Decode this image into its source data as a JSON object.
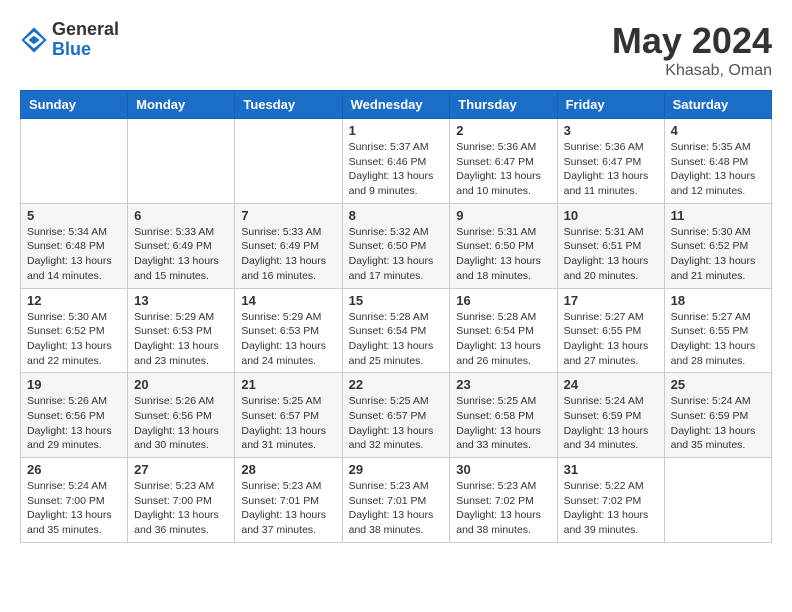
{
  "logo": {
    "general": "General",
    "blue": "Blue"
  },
  "title": {
    "month_year": "May 2024",
    "location": "Khasab, Oman"
  },
  "days_of_week": [
    "Sunday",
    "Monday",
    "Tuesday",
    "Wednesday",
    "Thursday",
    "Friday",
    "Saturday"
  ],
  "weeks": [
    [
      {
        "num": "",
        "detail": ""
      },
      {
        "num": "",
        "detail": ""
      },
      {
        "num": "",
        "detail": ""
      },
      {
        "num": "1",
        "detail": "Sunrise: 5:37 AM\nSunset: 6:46 PM\nDaylight: 13 hours\nand 9 minutes."
      },
      {
        "num": "2",
        "detail": "Sunrise: 5:36 AM\nSunset: 6:47 PM\nDaylight: 13 hours\nand 10 minutes."
      },
      {
        "num": "3",
        "detail": "Sunrise: 5:36 AM\nSunset: 6:47 PM\nDaylight: 13 hours\nand 11 minutes."
      },
      {
        "num": "4",
        "detail": "Sunrise: 5:35 AM\nSunset: 6:48 PM\nDaylight: 13 hours\nand 12 minutes."
      }
    ],
    [
      {
        "num": "5",
        "detail": "Sunrise: 5:34 AM\nSunset: 6:48 PM\nDaylight: 13 hours\nand 14 minutes."
      },
      {
        "num": "6",
        "detail": "Sunrise: 5:33 AM\nSunset: 6:49 PM\nDaylight: 13 hours\nand 15 minutes."
      },
      {
        "num": "7",
        "detail": "Sunrise: 5:33 AM\nSunset: 6:49 PM\nDaylight: 13 hours\nand 16 minutes."
      },
      {
        "num": "8",
        "detail": "Sunrise: 5:32 AM\nSunset: 6:50 PM\nDaylight: 13 hours\nand 17 minutes."
      },
      {
        "num": "9",
        "detail": "Sunrise: 5:31 AM\nSunset: 6:50 PM\nDaylight: 13 hours\nand 18 minutes."
      },
      {
        "num": "10",
        "detail": "Sunrise: 5:31 AM\nSunset: 6:51 PM\nDaylight: 13 hours\nand 20 minutes."
      },
      {
        "num": "11",
        "detail": "Sunrise: 5:30 AM\nSunset: 6:52 PM\nDaylight: 13 hours\nand 21 minutes."
      }
    ],
    [
      {
        "num": "12",
        "detail": "Sunrise: 5:30 AM\nSunset: 6:52 PM\nDaylight: 13 hours\nand 22 minutes."
      },
      {
        "num": "13",
        "detail": "Sunrise: 5:29 AM\nSunset: 6:53 PM\nDaylight: 13 hours\nand 23 minutes."
      },
      {
        "num": "14",
        "detail": "Sunrise: 5:29 AM\nSunset: 6:53 PM\nDaylight: 13 hours\nand 24 minutes."
      },
      {
        "num": "15",
        "detail": "Sunrise: 5:28 AM\nSunset: 6:54 PM\nDaylight: 13 hours\nand 25 minutes."
      },
      {
        "num": "16",
        "detail": "Sunrise: 5:28 AM\nSunset: 6:54 PM\nDaylight: 13 hours\nand 26 minutes."
      },
      {
        "num": "17",
        "detail": "Sunrise: 5:27 AM\nSunset: 6:55 PM\nDaylight: 13 hours\nand 27 minutes."
      },
      {
        "num": "18",
        "detail": "Sunrise: 5:27 AM\nSunset: 6:55 PM\nDaylight: 13 hours\nand 28 minutes."
      }
    ],
    [
      {
        "num": "19",
        "detail": "Sunrise: 5:26 AM\nSunset: 6:56 PM\nDaylight: 13 hours\nand 29 minutes."
      },
      {
        "num": "20",
        "detail": "Sunrise: 5:26 AM\nSunset: 6:56 PM\nDaylight: 13 hours\nand 30 minutes."
      },
      {
        "num": "21",
        "detail": "Sunrise: 5:25 AM\nSunset: 6:57 PM\nDaylight: 13 hours\nand 31 minutes."
      },
      {
        "num": "22",
        "detail": "Sunrise: 5:25 AM\nSunset: 6:57 PM\nDaylight: 13 hours\nand 32 minutes."
      },
      {
        "num": "23",
        "detail": "Sunrise: 5:25 AM\nSunset: 6:58 PM\nDaylight: 13 hours\nand 33 minutes."
      },
      {
        "num": "24",
        "detail": "Sunrise: 5:24 AM\nSunset: 6:59 PM\nDaylight: 13 hours\nand 34 minutes."
      },
      {
        "num": "25",
        "detail": "Sunrise: 5:24 AM\nSunset: 6:59 PM\nDaylight: 13 hours\nand 35 minutes."
      }
    ],
    [
      {
        "num": "26",
        "detail": "Sunrise: 5:24 AM\nSunset: 7:00 PM\nDaylight: 13 hours\nand 35 minutes."
      },
      {
        "num": "27",
        "detail": "Sunrise: 5:23 AM\nSunset: 7:00 PM\nDaylight: 13 hours\nand 36 minutes."
      },
      {
        "num": "28",
        "detail": "Sunrise: 5:23 AM\nSunset: 7:01 PM\nDaylight: 13 hours\nand 37 minutes."
      },
      {
        "num": "29",
        "detail": "Sunrise: 5:23 AM\nSunset: 7:01 PM\nDaylight: 13 hours\nand 38 minutes."
      },
      {
        "num": "30",
        "detail": "Sunrise: 5:23 AM\nSunset: 7:02 PM\nDaylight: 13 hours\nand 38 minutes."
      },
      {
        "num": "31",
        "detail": "Sunrise: 5:22 AM\nSunset: 7:02 PM\nDaylight: 13 hours\nand 39 minutes."
      },
      {
        "num": "",
        "detail": ""
      }
    ]
  ]
}
